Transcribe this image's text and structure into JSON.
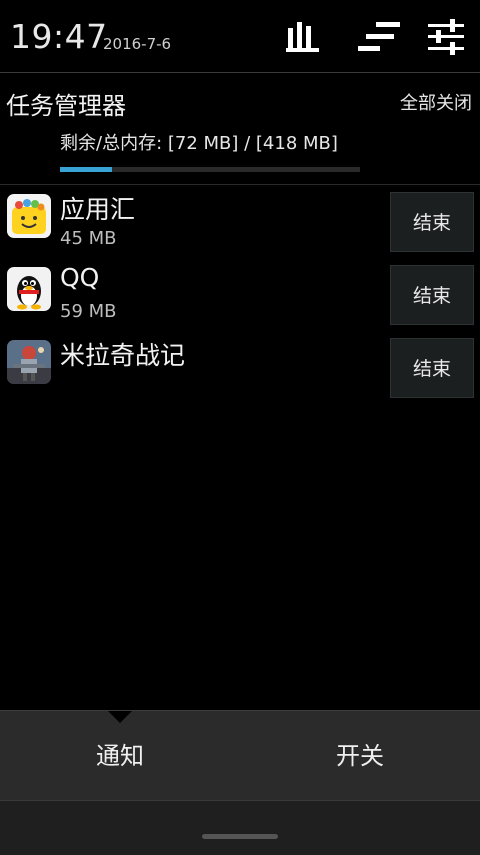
{
  "status_bar": {
    "time": "19:47",
    "date": "2016-7-6",
    "icons": [
      "signal-bars-icon",
      "sort-icon",
      "settings-sliders-icon"
    ]
  },
  "header": {
    "title": "任务管理器",
    "close_all_label": "全部关闭",
    "memory_text": "剩余/总内存: [72 MB] / [418 MB]",
    "memory_free_mb": 72,
    "memory_total_mb": 418,
    "accent_color": "#3aa3d6"
  },
  "apps": [
    {
      "name": "应用汇",
      "memory": "45 MB",
      "end_label": "结束",
      "icon": "app-store-bag-icon"
    },
    {
      "name": "QQ",
      "memory": "59 MB",
      "end_label": "结束",
      "icon": "qq-penguin-icon"
    },
    {
      "name": "米拉奇战记",
      "memory": "",
      "end_label": "结束",
      "icon": "game-warrior-icon"
    }
  ],
  "bottom_tabs": {
    "notify_label": "通知",
    "switch_label": "开关",
    "active": "notify"
  }
}
